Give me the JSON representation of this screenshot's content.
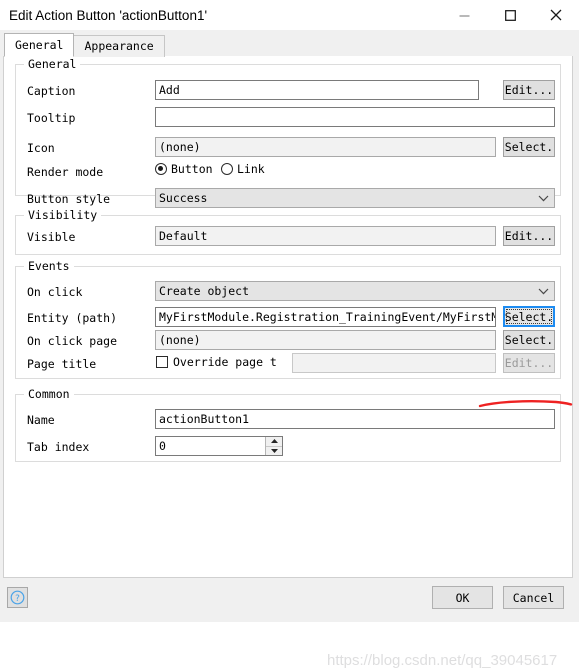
{
  "window": {
    "title": "Edit Action Button 'actionButton1'",
    "minimize_label": "minimize-icon",
    "maximize_label": "maximize-icon",
    "close_label": "close-icon"
  },
  "tabs": [
    {
      "label": "General",
      "active": true
    },
    {
      "label": "Appearance",
      "active": false
    }
  ],
  "groups": {
    "general": {
      "title": "General",
      "caption": {
        "label": "Caption",
        "value": "Add",
        "button": "Edit..."
      },
      "tooltip": {
        "label": "Tooltip",
        "value": ""
      },
      "icon": {
        "label": "Icon",
        "value": "(none)",
        "button": "Select."
      },
      "render_mode": {
        "label": "Render mode",
        "options": [
          {
            "label": "Button",
            "selected": true
          },
          {
            "label": "Link",
            "selected": false
          }
        ]
      },
      "button_style": {
        "label": "Button style",
        "value": "Success"
      }
    },
    "visibility": {
      "title": "Visibility",
      "visible": {
        "label": "Visible",
        "value": "Default",
        "button": "Edit..."
      }
    },
    "events": {
      "title": "Events",
      "on_click": {
        "label": "On click",
        "value": "Create object"
      },
      "entity_path": {
        "label": "Entity (path)",
        "value": "MyFirstModule.Registration_TrainingEvent/MyFirstModule.R",
        "button": "Select."
      },
      "on_click_page": {
        "label": "On click page",
        "value": "(none)",
        "button": "Select."
      },
      "page_title": {
        "label": "Page title",
        "checkbox_label": "Override page t",
        "checked": false,
        "value": "",
        "button": "Edit..."
      }
    },
    "common": {
      "title": "Common",
      "name": {
        "label": "Name",
        "value": "actionButton1"
      },
      "tab_index": {
        "label": "Tab index",
        "value": "0"
      }
    }
  },
  "footer": {
    "help_label": "?",
    "ok_label": "OK",
    "cancel_label": "Cancel"
  },
  "watermark": "https://blog.csdn.net/qq_39045617",
  "colors": {
    "accent_focus": "#1d8bf1",
    "annotation_red": "#ee2222",
    "window_bg": "#f0f0f0",
    "content_bg": "#ffffff",
    "readonly_bg": "#f2f2f2",
    "combo_bg": "#e4e4e4",
    "watermark": "#dededf"
  }
}
